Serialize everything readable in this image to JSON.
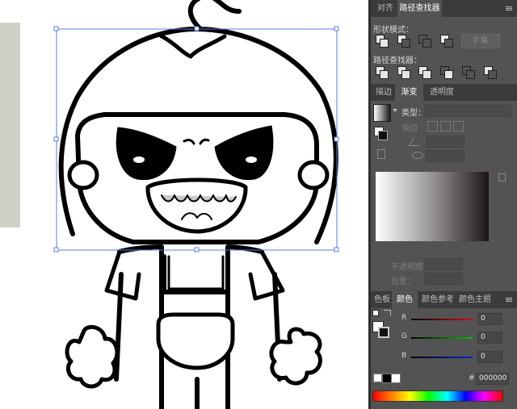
{
  "panel_top_tabs": [
    "对齐",
    "路径查找器"
  ],
  "shape_modes": {
    "label": "形状模式：",
    "expand_label": "扩展"
  },
  "pathfinders": {
    "label": "路径查找器："
  },
  "mid_tabs": [
    "描边",
    "渐变",
    "透明度"
  ],
  "gradient": {
    "type_label": "类型：",
    "stroke_label": "描边",
    "opacity_label": "不透明度：",
    "location_label": "位置："
  },
  "bottom_tabs": [
    "色板",
    "颜色",
    "颜色参考",
    "颜色主题"
  ],
  "color": {
    "r_label": "R",
    "g_label": "G",
    "b_label": "B",
    "r_value": "0",
    "g_value": "0",
    "b_value": "0",
    "hex_symbol": "#",
    "hex_value": "000000"
  },
  "colors": {
    "panel_bg": "#535353",
    "tabbar_bg": "#3b3b3b",
    "selection": "#5b7be0"
  }
}
